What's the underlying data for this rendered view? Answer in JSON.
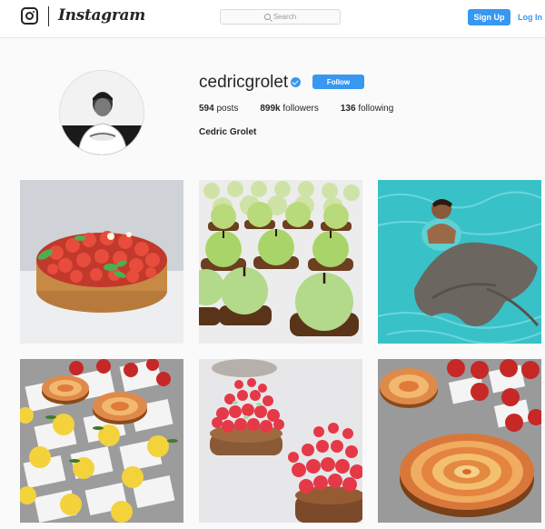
{
  "topbar": {
    "logo_text": "Instagram",
    "search_placeholder": "Search",
    "signup_label": "Sign Up",
    "login_label": "Log In"
  },
  "profile": {
    "username": "cedricgrolet",
    "verified": true,
    "follow_label": "Follow",
    "stats": {
      "posts_count": "594",
      "posts_label": "posts",
      "followers_count": "899k",
      "followers_label": "followers",
      "following_count": "136",
      "following_label": "following"
    },
    "full_name": "Cedric Grolet"
  },
  "posts": [
    {
      "subject": "strawberry-tart"
    },
    {
      "subject": "green-apple-pastries"
    },
    {
      "subject": "man-swimming-with-stingray"
    },
    {
      "subject": "apple-tarts-and-lemon-pastries"
    },
    {
      "subject": "raspberry-tartlets"
    },
    {
      "subject": "apple-rose-tart"
    }
  ],
  "colors": {
    "accent": "#3897f0",
    "background": "#fafafa",
    "text": "#262626"
  }
}
